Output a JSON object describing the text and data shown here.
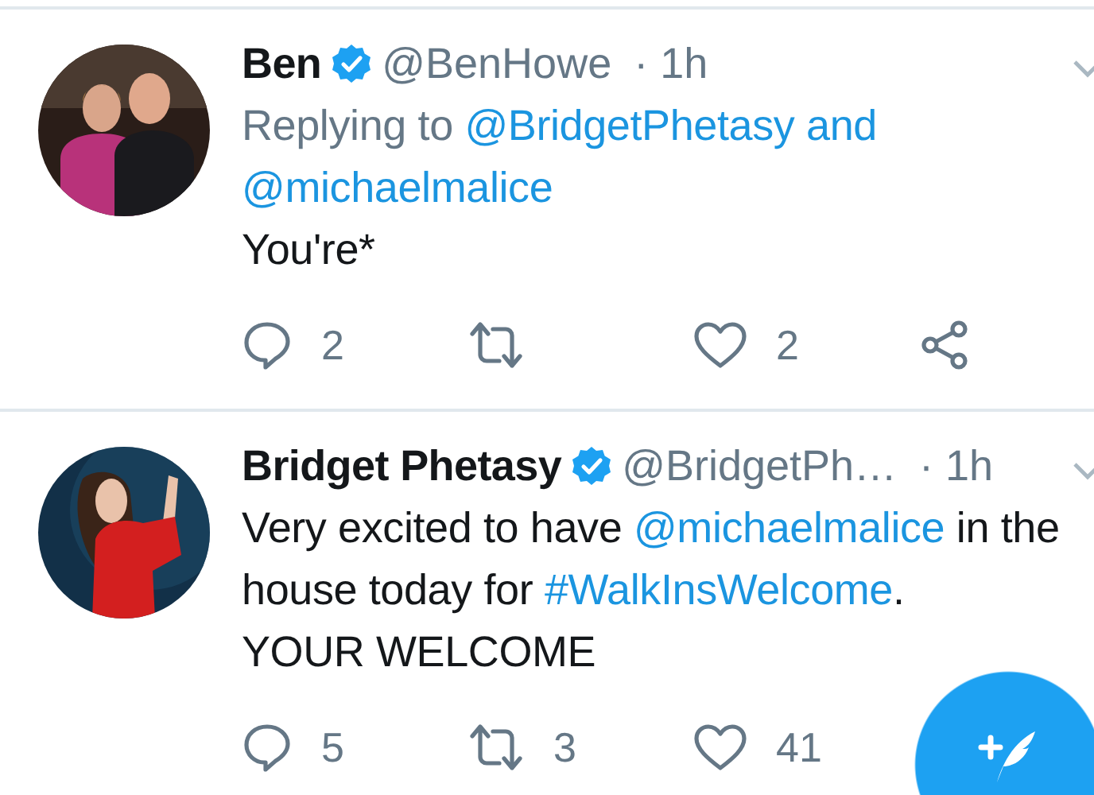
{
  "tweets": [
    {
      "name": "Ben",
      "verified": true,
      "handle": "@BenHowe",
      "time": "· 1h",
      "avatar": {
        "kind": "picture"
      },
      "reply_to": [
        {
          "kind": "text",
          "text": "Replying to "
        },
        {
          "kind": "link",
          "text": "@BridgetPhetasy"
        },
        {
          "kind": "accent",
          "text": " and "
        },
        {
          "kind": "link",
          "text": "@michaelmalice"
        }
      ],
      "body": [
        {
          "kind": "text",
          "text": "You're*"
        }
      ],
      "actions": [
        {
          "kind": "reply",
          "count": "2"
        },
        {
          "kind": "retweet"
        },
        {
          "kind": "like",
          "count": "2"
        },
        {
          "kind": "share"
        }
      ]
    },
    {
      "name": "Bridget Phetasy",
      "verified": true,
      "handle": "@BridgetPh…",
      "time": "· 1h",
      "avatar": {
        "kind": "picture"
      },
      "body": [
        {
          "kind": "text",
          "text": "Very excited to have "
        },
        {
          "kind": "link",
          "text": "@michaelmalice"
        },
        {
          "kind": "text",
          "text": " in the house today for "
        },
        {
          "kind": "link",
          "text": "#WalkInsWelcome"
        },
        {
          "kind": "text",
          "text": ".\nYOUR WELCOME"
        }
      ],
      "actions": [
        {
          "kind": "reply",
          "count": "5"
        },
        {
          "kind": "retweet",
          "count": "3"
        },
        {
          "kind": "like",
          "count": "41"
        }
      ]
    }
  ],
  "compose_button": {
    "kind": "fab"
  }
}
